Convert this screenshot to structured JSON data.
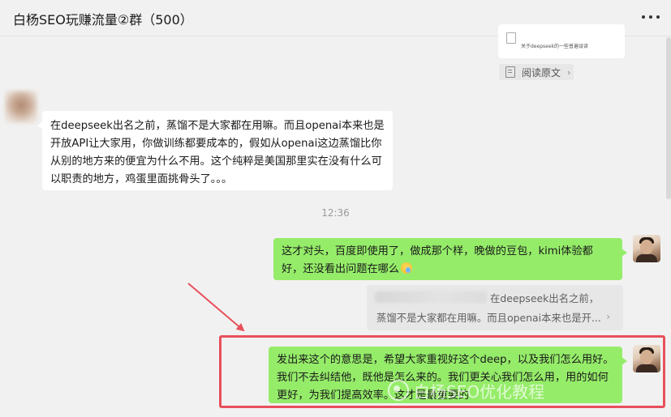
{
  "header": {
    "title": "白杨SEO玩赚流量②群（500）"
  },
  "shared_link": {
    "card_description": "关于deepseek的一些普遍误读",
    "source_label": "阅读原文"
  },
  "messages": [
    {
      "side": "left",
      "text": "在deepseek出名之前，蒸馏不是大家都在用嘛。而且openai本来也是开放API让大家用，你做训练都要成本的，假如从openai这边蒸馏比你从别的地方来的便宜为什么不用。这个纯粹是美国那里实在没有什么可以职责的地方，鸡蛋里面挑骨头了。。。"
    },
    {
      "side": "right",
      "text": "这才对头，百度即使用了，做成那个样，晚做的豆包，kimi体验都好，还没看出问题在哪么"
    },
    {
      "side": "right",
      "text": "发出来这个的意思是，希望大家重视好这个deep，以及我们怎么用好。我们不去纠结他，既他是怎么来的。我们更关心我们怎么用，用的如何更好，为我们提高效率。这才是最重要的"
    }
  ],
  "timestamp": "12:36",
  "quote": {
    "line1": "在deepseek出名之前，",
    "line2": "蒸馏不是大家都在用嘛。而且openai本来也是开..."
  },
  "watermark": {
    "text": "白杨SEO优化教程"
  },
  "colors": {
    "background": "#f1f1f1",
    "outgoing_bubble": "#95ec69",
    "incoming_bubble": "#ffffff",
    "annotation_red": "#e8505b"
  },
  "icons": {
    "more": "more-dots-icon",
    "document": "document-icon",
    "chevron": "chevron-right-icon"
  }
}
